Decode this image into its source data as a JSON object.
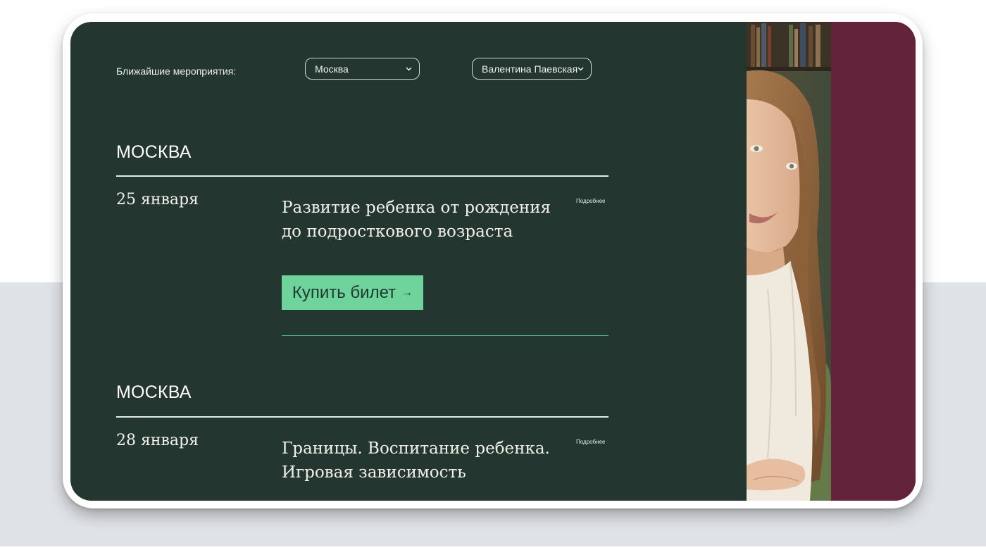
{
  "filters": {
    "label": "Ближайшие мероприятия:",
    "city": "Москва",
    "speaker": "Валентина Паевская"
  },
  "events": [
    {
      "city": "МОСКВА",
      "date": "25 января",
      "title_line1": "Развитие ребенка от рождения",
      "title_line2": "до подросткового возраста",
      "more": "Подробнее",
      "buy_label": "Купить билет",
      "buy_arrow": "→"
    },
    {
      "city": "МОСКВА",
      "date": "28 января",
      "title_line1": "Границы. Воспитание ребенка.",
      "title_line2": "Игровая зависимость",
      "more": "Подробнее"
    }
  ],
  "colors": {
    "panel": "#233630",
    "accent_green": "#6fd39c",
    "maroon": "#63233a",
    "page_gray": "#dfe2e6"
  },
  "icons": [
    "chevron-down-icon",
    "arrow-right-icon"
  ]
}
